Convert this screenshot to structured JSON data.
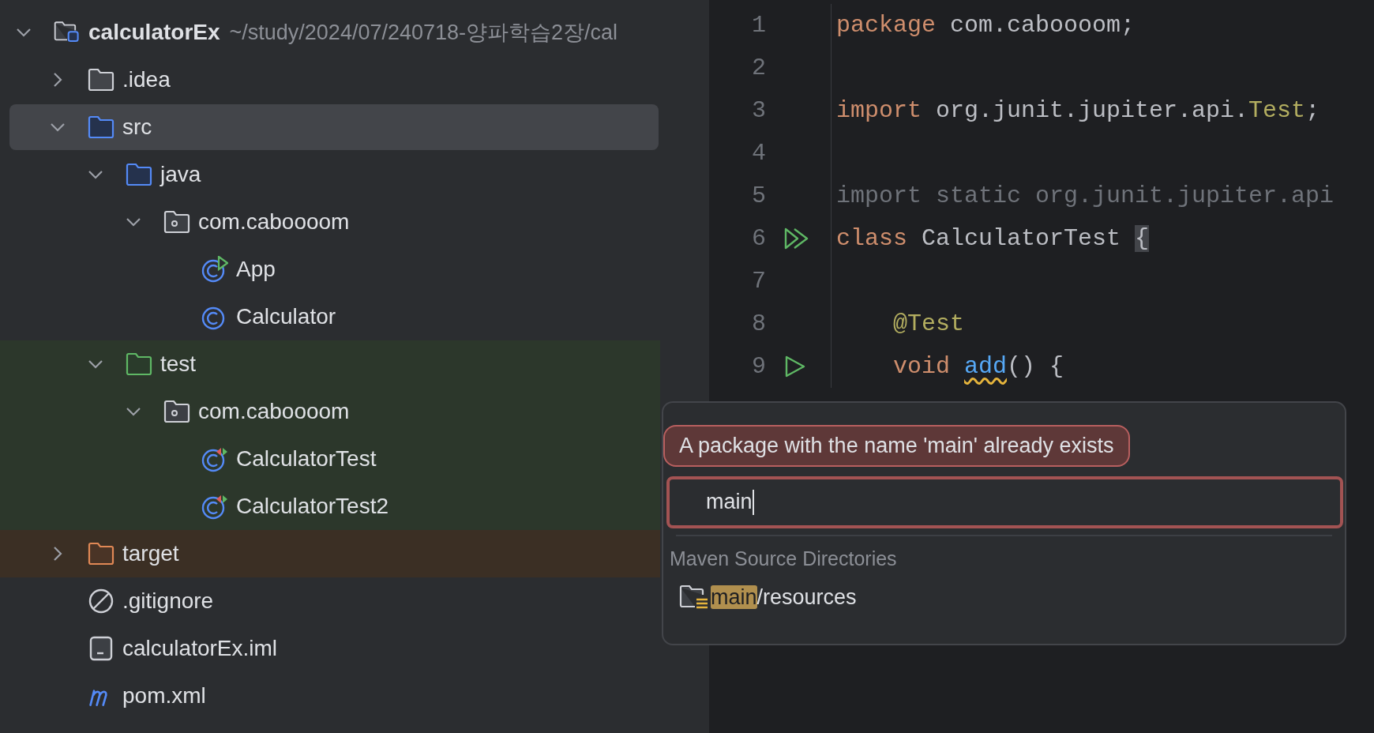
{
  "project_tree": {
    "root": {
      "name": "calculatorEx",
      "path": "~/study/2024/07/240718-양파학습2장/cal",
      "kind": "module",
      "expanded": true,
      "selected": false,
      "children": [
        {
          "name": ".idea",
          "kind": "folder",
          "expanded": false,
          "selected": false
        },
        {
          "name": "src",
          "kind": "source-root",
          "expanded": true,
          "selected": true,
          "children": [
            {
              "name": "java",
              "kind": "source-root",
              "expanded": true,
              "selected": false,
              "children": [
                {
                  "name": "com.caboooom",
                  "kind": "package",
                  "expanded": true,
                  "selected": false,
                  "children": [
                    {
                      "name": "App",
                      "kind": "main-class",
                      "selected": false
                    },
                    {
                      "name": "Calculator",
                      "kind": "class",
                      "selected": false
                    }
                  ]
                }
              ]
            },
            {
              "name": "test",
              "kind": "test-root",
              "expanded": true,
              "selected": false,
              "children": [
                {
                  "name": "com.caboooom",
                  "kind": "package",
                  "expanded": true,
                  "selected": false,
                  "children": [
                    {
                      "name": "CalculatorTest",
                      "kind": "test-class",
                      "selected": false
                    },
                    {
                      "name": "CalculatorTest2",
                      "kind": "test-class",
                      "selected": false
                    }
                  ]
                }
              ]
            }
          ]
        },
        {
          "name": "target",
          "kind": "excluded-folder",
          "expanded": false,
          "selected": false
        },
        {
          "name": ".gitignore",
          "kind": "ignore-file",
          "selected": false
        },
        {
          "name": "calculatorEx.iml",
          "kind": "module-file",
          "selected": false
        },
        {
          "name": "pom.xml",
          "kind": "maven-file",
          "selected": false
        }
      ]
    }
  },
  "editor": {
    "lines": [
      {
        "number": "1",
        "tokens": [
          {
            "kind": "keyword",
            "text": "package"
          },
          {
            "kind": "plain",
            "text": " com.caboooom;"
          }
        ]
      },
      {
        "number": "2"
      },
      {
        "number": "3",
        "tokens": [
          {
            "kind": "keyword",
            "text": "import"
          },
          {
            "kind": "plain",
            "text": " org.junit.jupiter.api."
          },
          {
            "kind": "annotation",
            "text": "Test"
          },
          {
            "kind": "plain",
            "text": ";"
          }
        ]
      },
      {
        "number": "4"
      },
      {
        "number": "5",
        "tokens": [
          {
            "kind": "unused",
            "text": "import static org.junit.jupiter.api"
          }
        ]
      },
      {
        "number": "6",
        "gutter": {
          "kind": "run_all"
        },
        "tokens": [
          {
            "kind": "keyword",
            "text": "class"
          },
          {
            "kind": "plain",
            "text": " CalculatorTest "
          },
          {
            "kind": "matched-brace",
            "text": "{"
          }
        ]
      },
      {
        "number": "7"
      },
      {
        "number": "8",
        "indented": true,
        "tokens": [
          {
            "kind": "annotation",
            "text": "@Test"
          }
        ]
      },
      {
        "number": "9",
        "indented": true,
        "gutter": {
          "kind": "run"
        },
        "tokens": [
          {
            "kind": "keyword",
            "text": "void"
          },
          {
            "kind": "warned-method",
            "text": "add",
            "space_before": true
          },
          {
            "kind": "plain",
            "text": "() {"
          }
        ]
      }
    ]
  },
  "new_package_popup": {
    "error": "A package with the name 'main' already exists",
    "value": "main",
    "invalid": true,
    "section": "Maven Source Directories",
    "suggestions": [
      {
        "parts": [
          {
            "text": "main",
            "highlighted": true
          },
          {
            "text": "/resources",
            "highlighted": false
          }
        ],
        "selected": false
      }
    ]
  }
}
